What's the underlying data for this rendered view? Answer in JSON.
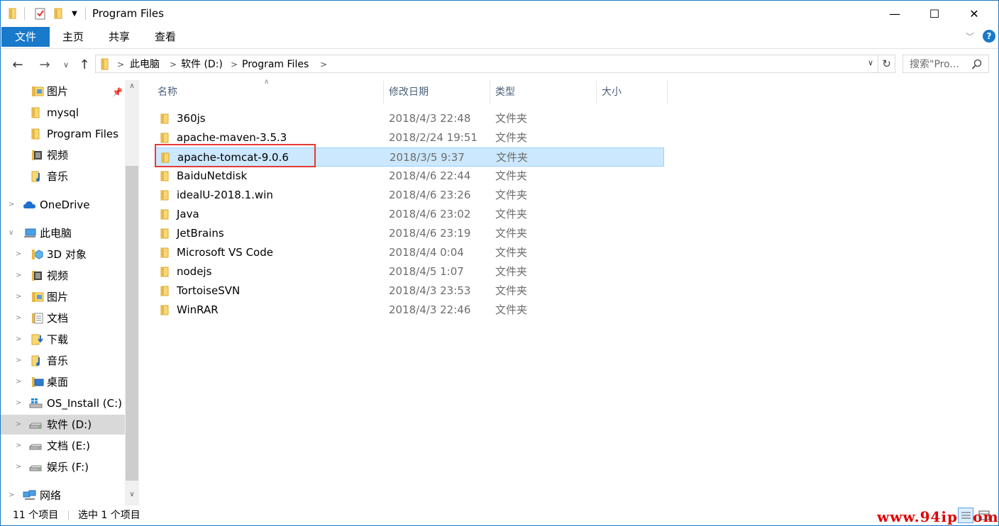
{
  "titlebar": {
    "title": "Program Files",
    "quick_access": [
      "folder-icon",
      "properties-icon",
      "new-folder-icon",
      "dropdown-icon"
    ],
    "controls": {
      "minimize": "—",
      "maximize": "☐",
      "close": "✕"
    }
  },
  "ribbon": {
    "tabs": [
      "文件",
      "主页",
      "共享",
      "查看"
    ],
    "active_tab": "文件",
    "accent": "#1979ca"
  },
  "address": {
    "crumbs": [
      "此电脑",
      "软件 (D:)",
      "Program Files"
    ],
    "search_placeholder": "搜索\"Pro..."
  },
  "sidebar": {
    "items": [
      {
        "label": "图片",
        "icon": "pictures-folder-icon",
        "pinned": true
      },
      {
        "label": "mysql",
        "icon": "folder-icon"
      },
      {
        "label": "Program Files",
        "icon": "folder-icon"
      },
      {
        "label": "视频",
        "icon": "videos-folder-icon"
      },
      {
        "label": "音乐",
        "icon": "music-folder-icon"
      },
      {
        "label": "OneDrive",
        "icon": "onedrive-cloud-icon"
      },
      {
        "label": "此电脑",
        "icon": "this-pc-icon"
      },
      {
        "label": "3D 对象",
        "icon": "3d-objects-icon"
      },
      {
        "label": "视频",
        "icon": "videos-folder-icon"
      },
      {
        "label": "图片",
        "icon": "pictures-folder-icon"
      },
      {
        "label": "文档",
        "icon": "documents-folder-icon"
      },
      {
        "label": "下载",
        "icon": "downloads-folder-icon"
      },
      {
        "label": "音乐",
        "icon": "music-folder-icon"
      },
      {
        "label": "桌面",
        "icon": "desktop-folder-icon"
      },
      {
        "label": "OS_Install (C:)",
        "icon": "windows-drive-icon"
      },
      {
        "label": "软件 (D:)",
        "icon": "drive-icon",
        "selected": true
      },
      {
        "label": "文档 (E:)",
        "icon": "drive-icon"
      },
      {
        "label": "娱乐 (F:)",
        "icon": "drive-icon"
      },
      {
        "label": "网络",
        "icon": "network-icon"
      }
    ]
  },
  "columns": [
    "名称",
    "修改日期",
    "类型",
    "大小"
  ],
  "files": [
    {
      "name": "360js",
      "date": "2018/4/3 22:48",
      "type": "文件夹"
    },
    {
      "name": "apache-maven-3.5.3",
      "date": "2018/2/24 19:51",
      "type": "文件夹"
    },
    {
      "name": "apache-tomcat-9.0.6",
      "date": "2018/3/5 9:37",
      "type": "文件夹",
      "selected": true
    },
    {
      "name": "BaiduNetdisk",
      "date": "2018/4/6 22:44",
      "type": "文件夹"
    },
    {
      "name": "idealU-2018.1.win",
      "date": "2018/4/6 23:26",
      "type": "文件夹"
    },
    {
      "name": "Java",
      "date": "2018/4/6 23:02",
      "type": "文件夹"
    },
    {
      "name": "JetBrains",
      "date": "2018/4/6 23:19",
      "type": "文件夹"
    },
    {
      "name": "Microsoft VS Code",
      "date": "2018/4/4 0:04",
      "type": "文件夹"
    },
    {
      "name": "nodejs",
      "date": "2018/4/5 1:07",
      "type": "文件夹"
    },
    {
      "name": "TortoiseSVN",
      "date": "2018/4/3 23:53",
      "type": "文件夹"
    },
    {
      "name": "WinRAR",
      "date": "2018/4/3 22:46",
      "type": "文件夹"
    }
  ],
  "status": {
    "item_count": "11 个项目",
    "selected_count": "选中 1 个项目"
  },
  "watermark": "www.94ip.com",
  "colors": {
    "selection_bg": "#cce8ff",
    "selection_border": "#99d1ff",
    "highlight_box": "#e53935",
    "folder_yellow": "#f8d775"
  }
}
